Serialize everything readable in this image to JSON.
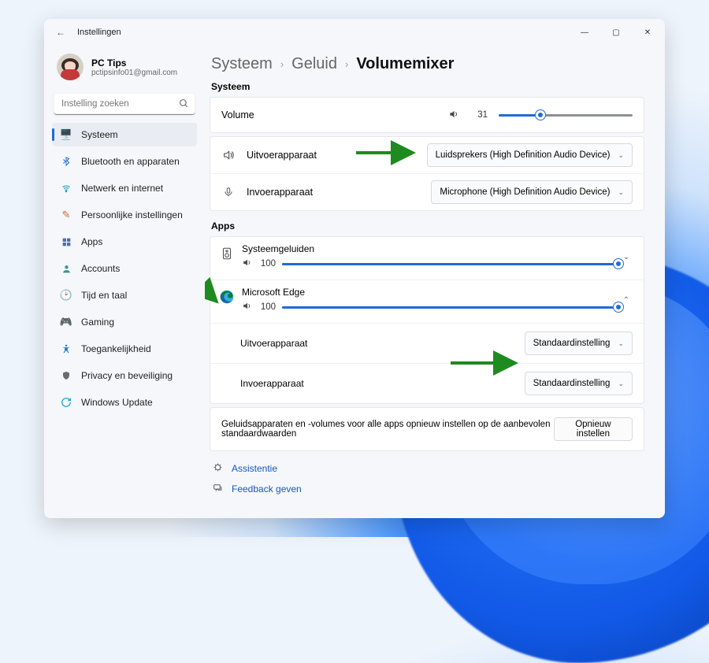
{
  "window": {
    "title": "Instellingen"
  },
  "profile": {
    "name": "PC Tips",
    "email": "pctipsinfo01@gmail.com"
  },
  "search": {
    "placeholder": "Instelling zoeken"
  },
  "sidebar": {
    "items": [
      {
        "label": "Systeem",
        "icon": "display",
        "selected": true
      },
      {
        "label": "Bluetooth en apparaten",
        "icon": "bluetooth",
        "selected": false
      },
      {
        "label": "Netwerk en internet",
        "icon": "wifi",
        "selected": false
      },
      {
        "label": "Persoonlijke instellingen",
        "icon": "brush",
        "selected": false
      },
      {
        "label": "Apps",
        "icon": "apps",
        "selected": false
      },
      {
        "label": "Accounts",
        "icon": "person",
        "selected": false
      },
      {
        "label": "Tijd en taal",
        "icon": "clock",
        "selected": false
      },
      {
        "label": "Gaming",
        "icon": "game",
        "selected": false
      },
      {
        "label": "Toegankelijkheid",
        "icon": "access",
        "selected": false
      },
      {
        "label": "Privacy en beveiliging",
        "icon": "shield",
        "selected": false
      },
      {
        "label": "Windows Update",
        "icon": "update",
        "selected": false
      }
    ]
  },
  "breadcrumbs": {
    "a": "Systeem",
    "b": "Geluid",
    "c": "Volumemixer"
  },
  "sections": {
    "system": "Systeem",
    "apps": "Apps"
  },
  "system": {
    "volume_label": "Volume",
    "volume_value": 31,
    "output_label": "Uitvoerapparaat",
    "output_value": "Luidsprekers (High Definition Audio Device)",
    "input_label": "Invoerapparaat",
    "input_value": "Microphone (High Definition Audio Device)"
  },
  "apps": [
    {
      "name": "Systeemgeluiden",
      "icon": "system-sounds",
      "volume": 100,
      "expanded": false
    },
    {
      "name": "Microsoft Edge",
      "icon": "edge",
      "volume": 100,
      "expanded": true,
      "output_label": "Uitvoerapparaat",
      "output_value": "Standaardinstelling",
      "input_label": "Invoerapparaat",
      "input_value": "Standaardinstelling"
    }
  ],
  "reset": {
    "text": "Geluidsapparaten en -volumes voor alle apps opnieuw instellen op de aanbevolen standaardwaarden",
    "button": "Opnieuw instellen"
  },
  "links": {
    "help": "Assistentie",
    "feedback": "Feedback geven"
  }
}
